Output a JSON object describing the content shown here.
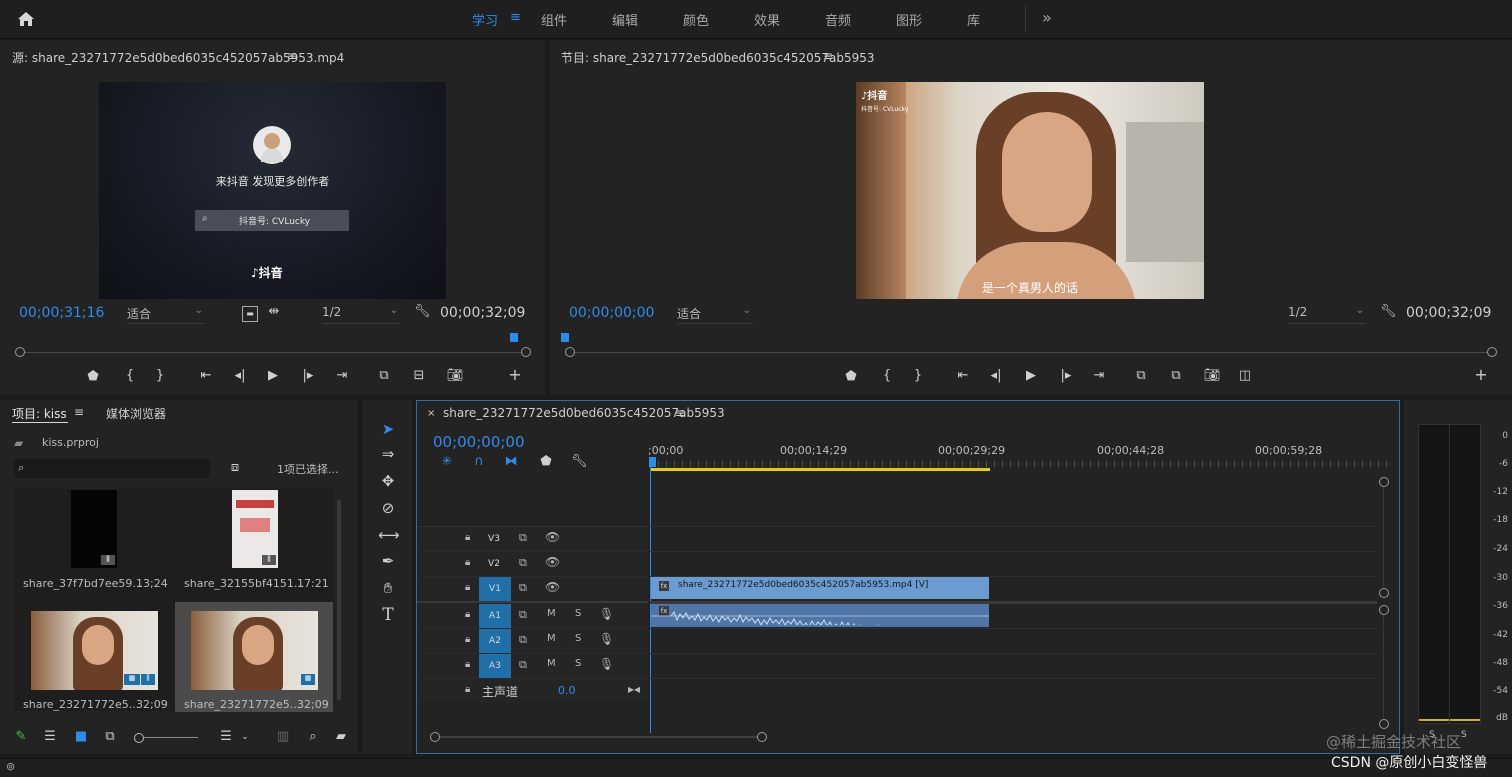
{
  "workspace": {
    "tabs": [
      {
        "label": "学习",
        "active": true
      },
      {
        "label": "组件"
      },
      {
        "label": "编辑"
      },
      {
        "label": "颜色"
      },
      {
        "label": "效果"
      },
      {
        "label": "音频"
      },
      {
        "label": "图形"
      },
      {
        "label": "库"
      }
    ],
    "more_label": "»",
    "menu_glyph": "≡"
  },
  "source_monitor": {
    "title": "源: share_23271772e5d0bed6035c452057ab5953.mp4",
    "menu_glyph": "≡",
    "timecode_current": "00;00;31;16",
    "fit_label": "适合",
    "resolution": "1/2",
    "timecode_duration": "00;00;32;09",
    "video": {
      "promo_text": "来抖音 发现更多创作者",
      "search_text": "抖音号: CVLucky",
      "brand_text": "抖音"
    }
  },
  "program_monitor": {
    "title": "节目: share_23271772e5d0bed6035c452057ab5953",
    "menu_glyph": "≡",
    "timecode_current": "00;00;00;00",
    "fit_label": "适合",
    "resolution": "1/2",
    "timecode_duration": "00;00;32;09",
    "video": {
      "brand_text": "抖音",
      "id_text": "抖音号: CVLucky",
      "subtitle": "是一个真男人的话"
    }
  },
  "project_panel": {
    "tab_project": "项目: kiss",
    "tab_media": "媒体浏览器",
    "menu_glyph": "≡",
    "project_file": "kiss.prproj",
    "selection_text": "1项已选择...",
    "items": [
      {
        "name": "share_37f7bd7ee59...",
        "duration": "13;24"
      },
      {
        "name": "share_32155bf4151...",
        "duration": "17:21"
      },
      {
        "name": "share_23271772e5...",
        "duration": "32;09"
      },
      {
        "name": "share_23271772e5...",
        "duration": "32;09"
      }
    ]
  },
  "timeline": {
    "close_glyph": "×",
    "sequence_title": "share_23271772e5d0bed6035c452057ab5953",
    "menu_glyph": "≡",
    "timecode": "00;00;00;00",
    "ruler_labels": [
      ";00;00",
      "00;00;14;29",
      "00;00;29;29",
      "00;00;44;28",
      "00;00;59;28"
    ],
    "video_tracks": [
      "V3",
      "V2",
      "V1"
    ],
    "audio_tracks": [
      "A1",
      "A2",
      "A3"
    ],
    "track_mute": "M",
    "track_solo": "S",
    "master_label": "主声道",
    "master_value": "0.0",
    "clip_label": "share_23271772e5d0bed6035c452057ab5953.mp4 [V]",
    "fx_badge": "fx"
  },
  "audio_meter": {
    "db_labels": [
      "0",
      "-6",
      "-12",
      "-18",
      "-24",
      "-30",
      "-36",
      "-42",
      "-48",
      "-54",
      "dB"
    ],
    "solo_labels": [
      "S",
      "S"
    ]
  },
  "watermark": {
    "line1": "@稀土掘金技术社区",
    "line2": "CSDN @原创小白变怪兽"
  },
  "colors": {
    "accent": "#2d8ceb",
    "clip_video": "#6a9bd1",
    "clip_audio": "#4f76a6",
    "track_on": "#1f6fa8",
    "work_area": "#e3d000"
  }
}
